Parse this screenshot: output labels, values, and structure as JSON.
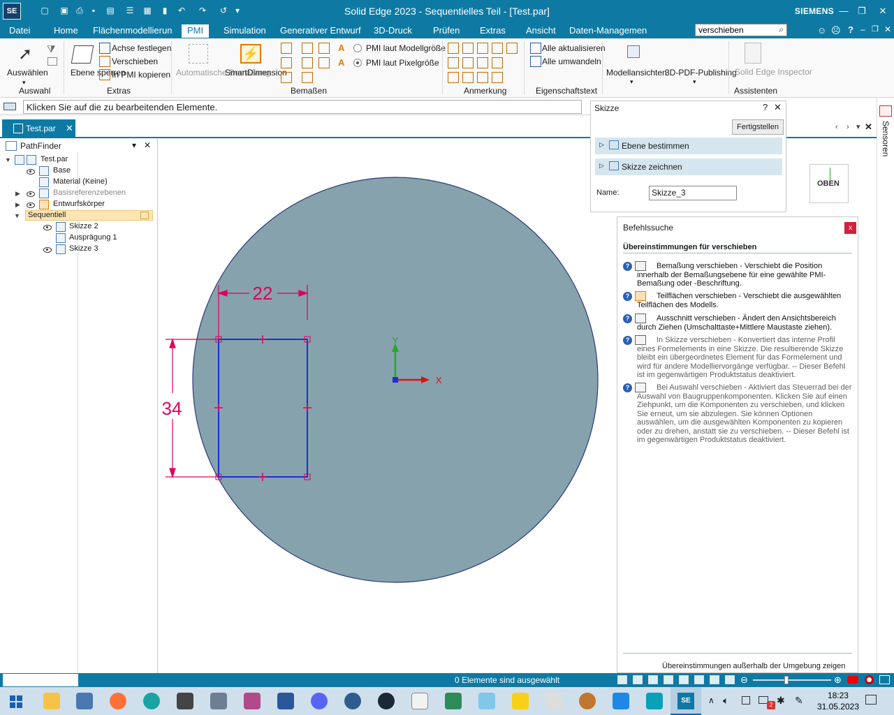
{
  "titlebar": {
    "app_icon": "SE",
    "title": "Solid Edge 2023 - Sequentielles Teil - [Test.par]",
    "brand": "SIEMENS",
    "qat_icons": [
      "new-icon",
      "open-icon",
      "print-icon",
      "save-icon",
      "save-as-icon",
      "undo-icon",
      "redo-icon"
    ],
    "window_controls": [
      "minimize-icon",
      "restore-icon",
      "close-icon"
    ]
  },
  "menubar": {
    "tabs": [
      "Datei",
      "Home",
      "Flächenmodellierun",
      "PMI",
      "Simulation",
      "Generativer Entwurf",
      "3D-Druck",
      "Prüfen",
      "Extras",
      "Ansicht",
      "Daten-Managemen"
    ],
    "active_tab": "PMI",
    "search_value": "verschieben"
  },
  "ribbon": {
    "auswahl": {
      "button": "Auswählen",
      "group": "Auswahl"
    },
    "extras": {
      "ebene_sperren": "Ebene sperren",
      "achse_festlegen": "Achse festlegen",
      "verschieben": "Verschieben",
      "in_pmi_kopieren": "In PMI kopieren",
      "group": "Extras"
    },
    "bemassen": {
      "automatische_bemassung": "Automatische Bemaßung",
      "smart_dimension": "SmartDimension",
      "pmi_modell": "PMI laut Modellgröße",
      "pmi_pixel": "PMI laut Pixelgröße",
      "group": "Bemaßen"
    },
    "anmerkung": {
      "group": "Anmerkung"
    },
    "eigenschaftstext": {
      "alle_aktualisieren": "Alle aktualisieren",
      "alle_umwandeln": "Alle umwandeln",
      "group": "Eigenschaftstext"
    },
    "modellansichten": "Modellansichten",
    "publishing": "3D-PDF-Publishing",
    "assistenten": {
      "inspector": "Solid Edge Inspector",
      "group": "Assistenten"
    }
  },
  "prompt": {
    "text": "Klicken Sie auf die zu bearbeitenden Elemente."
  },
  "document_tab": {
    "label": "Test.par"
  },
  "pathfinder": {
    "title": "PathFinder",
    "items": [
      {
        "label": "Test.par"
      },
      {
        "label": "Base"
      },
      {
        "label": "Material (Keine)"
      },
      {
        "label": "Basisreferenzebenen"
      },
      {
        "label": "Entwurfskörper"
      },
      {
        "label": "Sequentiell"
      },
      {
        "label": "Skizze 2"
      },
      {
        "label": "Ausprägung 1"
      },
      {
        "label": "Skizze 3"
      }
    ]
  },
  "canvas": {
    "dim_width": "22",
    "dim_height": "34",
    "axis_y": "Y",
    "axis_x": "X",
    "view_cube": "OBEN"
  },
  "skizze_panel": {
    "title": "Skizze",
    "finish_button": "Fertigstellen",
    "step_ebene": "Ebene bestimmen",
    "step_zeichnen": "Skizze zeichnen",
    "name_label": "Name:",
    "name_value": "Skizze_3"
  },
  "befehlssuche": {
    "title": "Befehlssuche",
    "heading": "Übereinstimmungen für  verschieben",
    "items": [
      {
        "text": "Bemaßung verschieben - Verschiebt die Position innerhalb der Bemaßungsebene für eine gewählte PMI-Bemaßung oder -Beschriftung."
      },
      {
        "text": "Teilflächen verschieben - Verschiebt die ausgewählten Teilflächen des Modells."
      },
      {
        "text": "Ausschnitt verschieben - Ändert den Ansichtsbereich durch Ziehen (Umschalttaste+Mittlere Maustaste ziehen)."
      },
      {
        "text": "In Skizze verschieben - Konvertiert das interne Profil eines Formelements in eine Skizze. Die resultierende Skizze bleibt ein übergeordnetes Element für das Formelement und wird für andere Modelliervorgänge verfügbar. -- Dieser Befehl ist im gegenwärtigen Produktstatus deaktiviert."
      },
      {
        "text": "Bei Auswahl verschieben - Aktiviert das Steuerrad bei der Auswahl von Baugruppenkomponenten. Klicken Sie auf einen Ziehpunkt, um die Komponenten zu verschieben, und klicken Sie erneut, um sie abzulegen. Sie können Optionen auswählen, um die ausgewählten Komponenten zu kopieren oder zu drehen, anstatt sie zu verschieben. -- Dieser Befehl ist im gegenwärtigen Produktstatus deaktiviert."
      }
    ],
    "footer_link": "Übereinstimmungen außerhalb der Umgebung zeigen"
  },
  "sensor_strip": {
    "label": "Sensoren"
  },
  "statusbar": {
    "text": "0 Elemente sind ausgewählt"
  },
  "taskbar": {
    "time": "18:23",
    "date": "31.05.2023",
    "notification_badge": "2",
    "apps": [
      "windows-start-icon",
      "file-explorer-icon",
      "app-icon",
      "firefox-icon",
      "edge-icon",
      "app-icon",
      "calculator-icon",
      "app-icon",
      "app-icon",
      "discord-icon",
      "app-icon",
      "steam-icon",
      "notepad-icon",
      "app-icon",
      "app-icon",
      "sticky-notes-icon",
      "app-icon",
      "app-icon",
      "app-icon",
      "app-icon",
      "solid-edge-icon"
    ]
  },
  "colors": {
    "accent": "#0e7aa3",
    "part_fill": "#86a2ad",
    "sketch_line": "#1a2fd8",
    "dimension": "#e0005a"
  }
}
